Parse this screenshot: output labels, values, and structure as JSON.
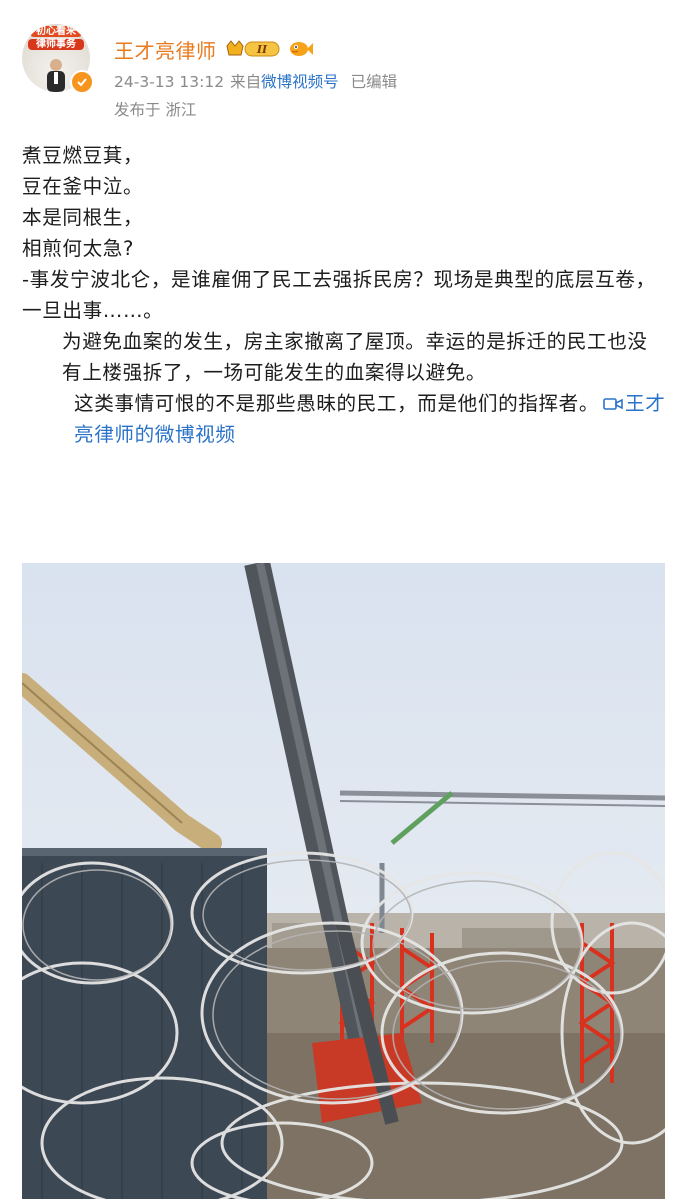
{
  "post": {
    "author": {
      "name": "王才亮律师",
      "avatar_banner_line1": "初心看来",
      "avatar_banner_line2": "律师事务"
    },
    "meta": {
      "time": "24-3-13 13:12",
      "source_prefix": "来自",
      "source": "微博视频号",
      "edited": "已编辑"
    },
    "location": "发布于 浙江",
    "content": {
      "poem_lines": [
        "煮豆燃豆萁，",
        "豆在釜中泣。",
        "本是同根生，",
        "相煎何太急?"
      ],
      "para1": "-事发宁波北仑，是谁雇佣了民工去强拆民房？现场是典型的底层互卷，一旦出事……。",
      "para2": "为避免血案的发生，房主家撤离了屋顶。幸运的是拆迁的民工也没有上楼强拆了，一场可能发生的血案得以避免。",
      "para3": "这类事情可恨的不是那些愚昧的民工，而是他们的指挥者。",
      "video_link": "王才亮律师的微博视频"
    }
  },
  "colors": {
    "name": "#ea7a1e",
    "link": "#2a73c9",
    "meta": "#8a8a8a"
  },
  "icons": [
    "verified-badge-icon",
    "vip-level-badge-icon",
    "fish-emoji-icon",
    "video-camera-icon"
  ]
}
